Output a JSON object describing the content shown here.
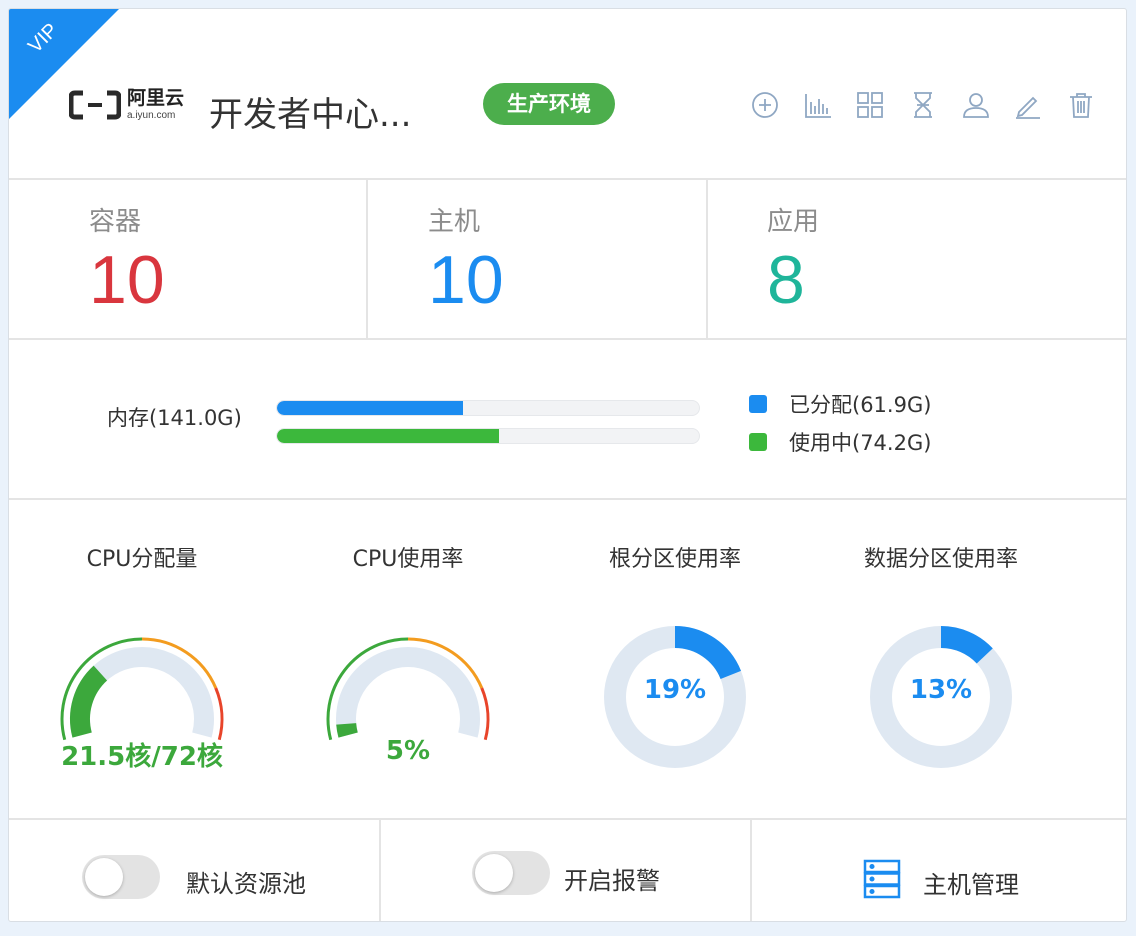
{
  "header": {
    "ribbon": "VIP",
    "logo": {
      "cn": "阿里云",
      "en": "a.iyun.com"
    },
    "title": "开发者中心...",
    "env_badge": "生产环境",
    "tools": [
      "add-icon",
      "chart-icon",
      "grid-icon",
      "hourglass-icon",
      "user-icon",
      "edit-icon",
      "trash-icon"
    ]
  },
  "stats": [
    {
      "label": "容器",
      "value": "10",
      "color": "#d9363e"
    },
    {
      "label": "主机",
      "value": "10",
      "color": "#1b8cf0"
    },
    {
      "label": "应用",
      "value": "8",
      "color": "#1fb59a"
    }
  ],
  "memory": {
    "label": "内存(141.0G)",
    "allocated": {
      "label": "已分配(61.9G)",
      "fraction": 0.44,
      "color": "#1b8cf0"
    },
    "used": {
      "label": "使用中(74.2G)",
      "fraction": 0.526,
      "color": "#3cb83c"
    }
  },
  "gauges": [
    {
      "title": "CPU分配量",
      "type": "arc",
      "value_text": "21.5核/72核",
      "fraction": 0.299,
      "color": "#3ca83c"
    },
    {
      "title": "CPU使用率",
      "type": "arc",
      "value_text": "5%",
      "fraction": 0.05,
      "color": "#3ca83c"
    },
    {
      "title": "根分区使用率",
      "type": "donut",
      "value_text": "19%",
      "fraction": 0.19,
      "color": "#1b8cf0"
    },
    {
      "title": "数据分区使用率",
      "type": "donut",
      "value_text": "13%",
      "fraction": 0.13,
      "color": "#1b8cf0"
    }
  ],
  "footer": {
    "default_pool": {
      "label": "默认资源池",
      "on": false
    },
    "alarm": {
      "label": "开启报警",
      "on": false
    },
    "host_manage": {
      "label": "主机管理"
    }
  }
}
